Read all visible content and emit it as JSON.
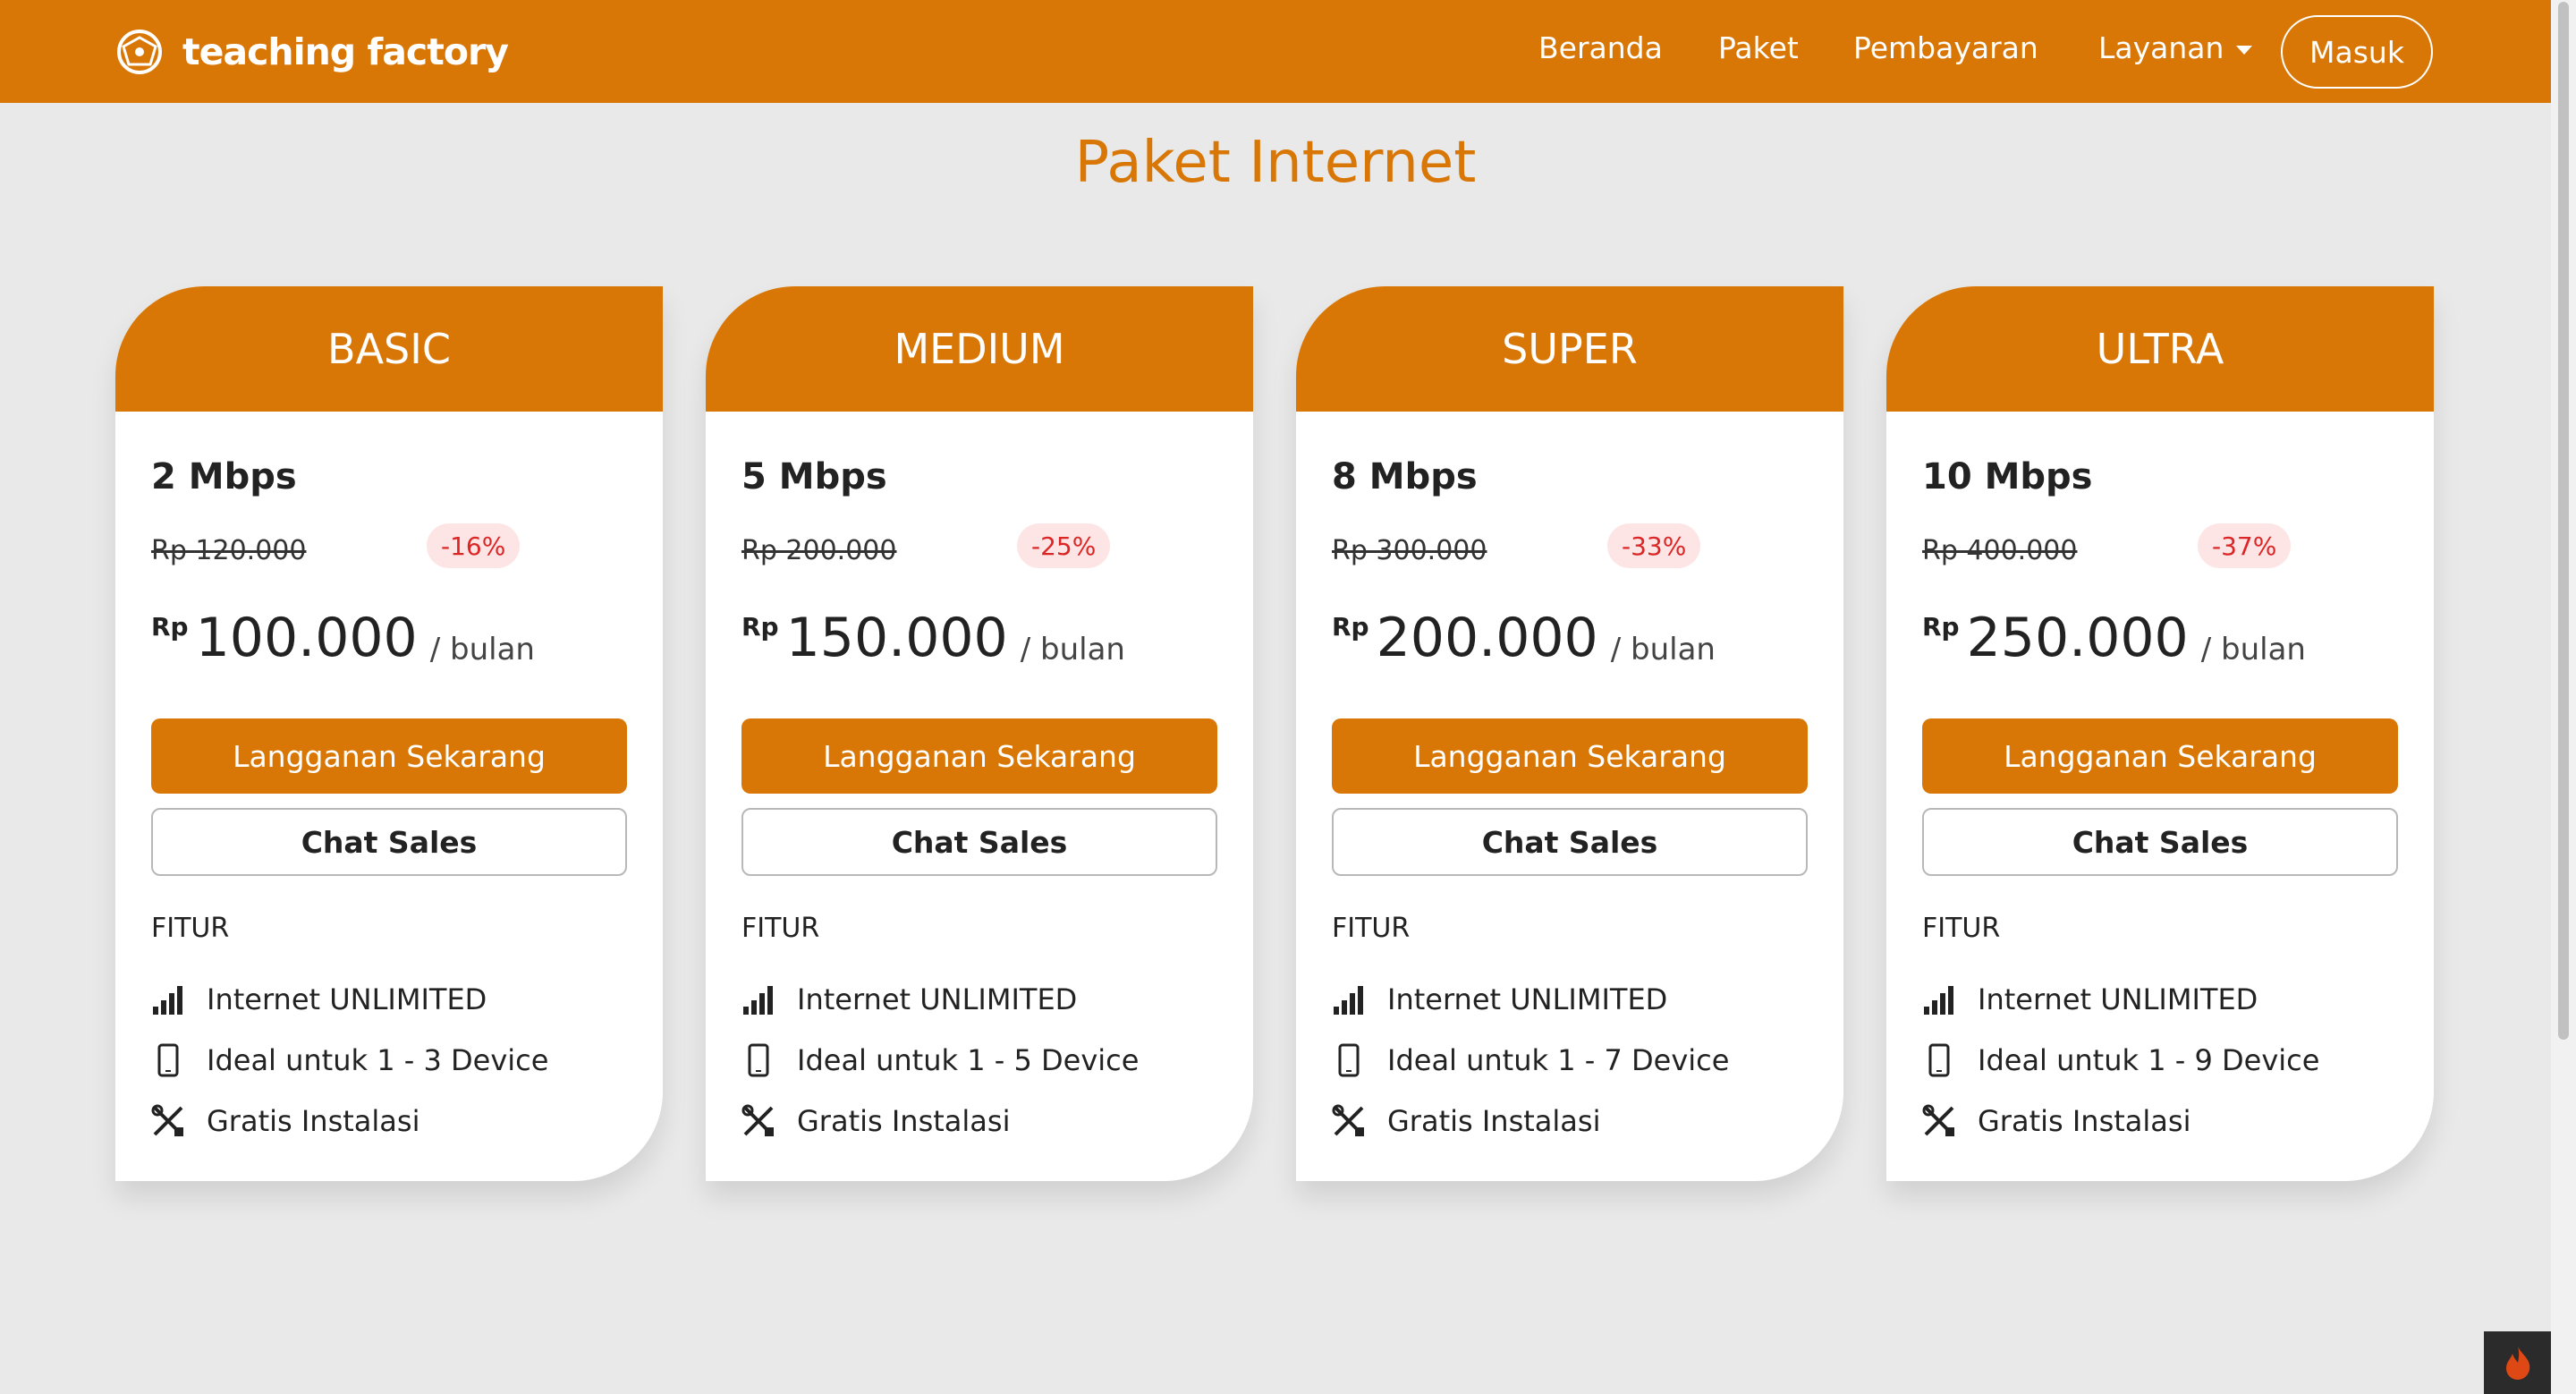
{
  "brand": {
    "name": "teaching factory"
  },
  "nav": {
    "items": [
      "Beranda",
      "Paket",
      "Pembayaran",
      "Layanan"
    ],
    "login": "Masuk"
  },
  "page": {
    "title": "Paket Internet"
  },
  "plans": [
    {
      "name": "BASIC",
      "speed": "2 Mbps",
      "old_price": "Rp 120.000",
      "discount": "-16%",
      "currency": "Rp",
      "price": "100.000",
      "period": "/ bulan",
      "subscribe": "Langganan Sekarang",
      "chat": "Chat Sales",
      "features_title": "FITUR",
      "features": [
        "Internet UNLIMITED",
        "Ideal untuk 1 - 3 Device",
        "Gratis Instalasi"
      ]
    },
    {
      "name": "MEDIUM",
      "speed": "5 Mbps",
      "old_price": "Rp 200.000",
      "discount": "-25%",
      "currency": "Rp",
      "price": "150.000",
      "period": "/ bulan",
      "subscribe": "Langganan Sekarang",
      "chat": "Chat Sales",
      "features_title": "FITUR",
      "features": [
        "Internet UNLIMITED",
        "Ideal untuk 1 - 5 Device",
        "Gratis Instalasi"
      ]
    },
    {
      "name": "SUPER",
      "speed": "8 Mbps",
      "old_price": "Rp 300.000",
      "discount": "-33%",
      "currency": "Rp",
      "price": "200.000",
      "period": "/ bulan",
      "subscribe": "Langganan Sekarang",
      "chat": "Chat Sales",
      "features_title": "FITUR",
      "features": [
        "Internet UNLIMITED",
        "Ideal untuk 1 - 7 Device",
        "Gratis Instalasi"
      ]
    },
    {
      "name": "ULTRA",
      "speed": "10 Mbps",
      "old_price": "Rp 400.000",
      "discount": "-37%",
      "currency": "Rp",
      "price": "250.000",
      "period": "/ bulan",
      "subscribe": "Langganan Sekarang",
      "chat": "Chat Sales",
      "features_title": "FITUR",
      "features": [
        "Internet UNLIMITED",
        "Ideal untuk 1 - 9 Device",
        "Gratis Instalasi"
      ]
    }
  ],
  "icons": [
    "globe-logo-icon",
    "caret-down-icon",
    "signal-bars-icon",
    "smartphone-icon",
    "tools-icon",
    "flame-icon"
  ],
  "colors": {
    "accent": "#d97706",
    "background": "#e9e9e9",
    "discount_bg": "#fde5e5",
    "discount_text": "#dc2626"
  }
}
